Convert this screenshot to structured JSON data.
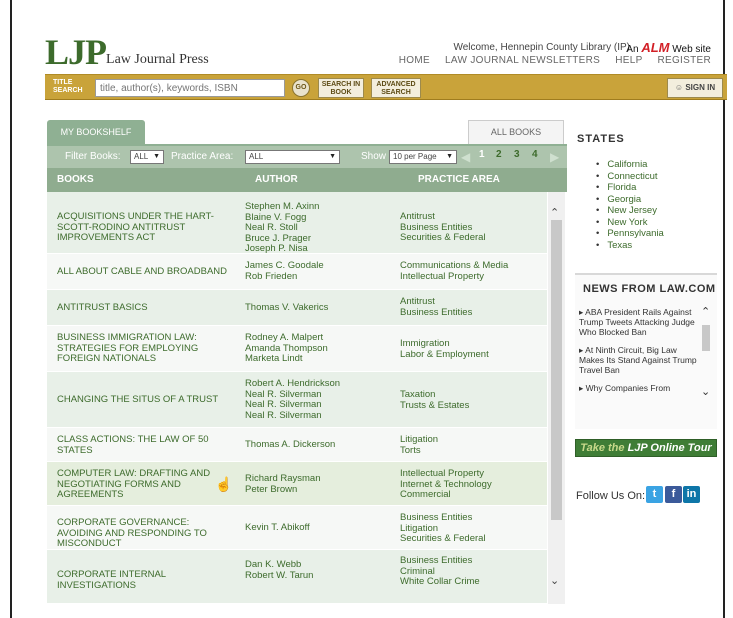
{
  "header": {
    "logo_main": "LJP",
    "logo_sub": "Law Journal Press",
    "welcome": "Welcome, Hennepin County Library (IP)",
    "alm_prefix": "An",
    "alm_brand": "ALM",
    "alm_suffix": "Web site",
    "nav": [
      "HOME",
      "LAW JOURNAL NEWSLETTERS",
      "HELP",
      "REGISTER"
    ]
  },
  "search": {
    "label": "TITLE SEARCH",
    "placeholder": "title, author(s), keywords, ISBN",
    "go": "GO",
    "search_in_book": "SEARCH IN BOOK",
    "advanced_search": "ADVANCED SEARCH",
    "sign_in": "SIGN IN"
  },
  "tabs": {
    "my_bookshelf": "MY BOOKSHELF",
    "all_books": "ALL BOOKS"
  },
  "filters": {
    "filter_books_label": "Filter Books:",
    "filter_books_value": "ALL",
    "practice_area_label": "Practice Area:",
    "practice_area_value": "ALL",
    "show_label": "Show",
    "show_value": "10 per Page",
    "pages": [
      "1",
      "2",
      "3",
      "4"
    ]
  },
  "table": {
    "headers": [
      "BOOKS",
      "AUTHOR",
      "PRACTICE AREA"
    ],
    "rows": [
      {
        "title": "ACQUISITIONS UNDER THE HART-SCOTT-RODINO ANTITRUST IMPROVEMENTS ACT",
        "authors": "Stephen M. Axinn\nBlaine V. Fogg\nNeal R. Stoll\nBruce J. Prager\nJoseph P. Nisa",
        "areas": "Antitrust\nBusiness Entities\nSecurities & Federal"
      },
      {
        "title": "ALL ABOUT CABLE AND BROADBAND",
        "authors": "James C. Goodale\nRob Frieden",
        "areas": "Communications & Media\nIntellectual Property"
      },
      {
        "title": "ANTITRUST BASICS",
        "authors": "Thomas V. Vakerics",
        "areas": "Antitrust\nBusiness Entities"
      },
      {
        "title": "BUSINESS IMMIGRATION LAW: STRATEGIES FOR EMPLOYING FOREIGN NATIONALS",
        "authors": "Rodney A. Malpert\nAmanda Thompson\nMarketa Lindt",
        "areas": "Immigration\nLabor & Employment"
      },
      {
        "title": "CHANGING THE SITUS OF A TRUST",
        "authors": "Robert A. Hendrickson\nNeal R. Silverman\nNeal R. Silverman\nNeal R. Silverman",
        "areas": "Taxation\nTrusts & Estates"
      },
      {
        "title": "CLASS ACTIONS: THE LAW OF 50 STATES",
        "authors": "Thomas A. Dickerson",
        "areas": "Litigation\nTorts"
      },
      {
        "title": "COMPUTER LAW: DRAFTING AND NEGOTIATING FORMS AND AGREEMENTS",
        "authors": "Richard Raysman\nPeter Brown",
        "areas": "Intellectual Property\nInternet & Technology\nCommercial"
      },
      {
        "title": "CORPORATE GOVERNANCE: AVOIDING AND RESPONDING TO MISCONDUCT",
        "authors": "Kevin T. Abikoff",
        "areas": "Business Entities\nLitigation\nSecurities & Federal"
      },
      {
        "title": "CORPORATE INTERNAL INVESTIGATIONS",
        "authors": "Dan K. Webb\nRobert W. Tarun",
        "areas": "Business Entities\nCriminal\nWhite Collar Crime"
      }
    ]
  },
  "sidebar": {
    "states_title": "STATES",
    "states": [
      "California",
      "Connecticut",
      "Florida",
      "Georgia",
      "New Jersey",
      "New York",
      "Pennsylvania",
      "Texas"
    ],
    "news_title": "NEWS FROM LAW.COM",
    "news": [
      "ABA President Rails Against Trump Tweets Attacking Judge Who Blocked Ban",
      "At Ninth Circuit, Big Law Makes Its Stand Against Trump Travel Ban",
      "Why Companies From"
    ],
    "tour_take": "Take the",
    "tour_rest": "LJP Online Tour",
    "follow": "Follow Us On:",
    "social": [
      "twitter-icon",
      "facebook-icon",
      "linkedin-icon"
    ]
  },
  "colors": {
    "brand_green": "#3d6b2c",
    "search_gold": "#c9a33a",
    "alm_red": "#d21f26",
    "table_header": "#8fac8f"
  }
}
